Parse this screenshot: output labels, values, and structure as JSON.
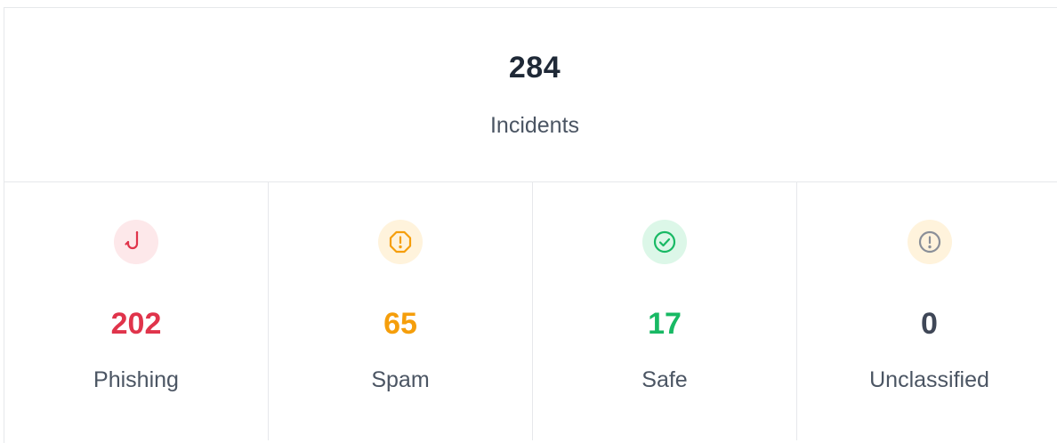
{
  "summary": {
    "total": "284",
    "label": "Incidents"
  },
  "categories": [
    {
      "count": "202",
      "label": "Phishing",
      "icon": "fishhook-icon",
      "color": "#e0344b",
      "badge_bg": "#fde8ea"
    },
    {
      "count": "65",
      "label": "Spam",
      "icon": "octagon-alert-icon",
      "color": "#f59e0b",
      "badge_bg": "#fff3dc"
    },
    {
      "count": "17",
      "label": "Safe",
      "icon": "check-circle-icon",
      "color": "#18b964",
      "badge_bg": "#dcf7e8"
    },
    {
      "count": "0",
      "label": "Unclassified",
      "icon": "circle-alert-icon",
      "color": "#3f4757",
      "badge_bg": "#fff3dc"
    }
  ]
}
